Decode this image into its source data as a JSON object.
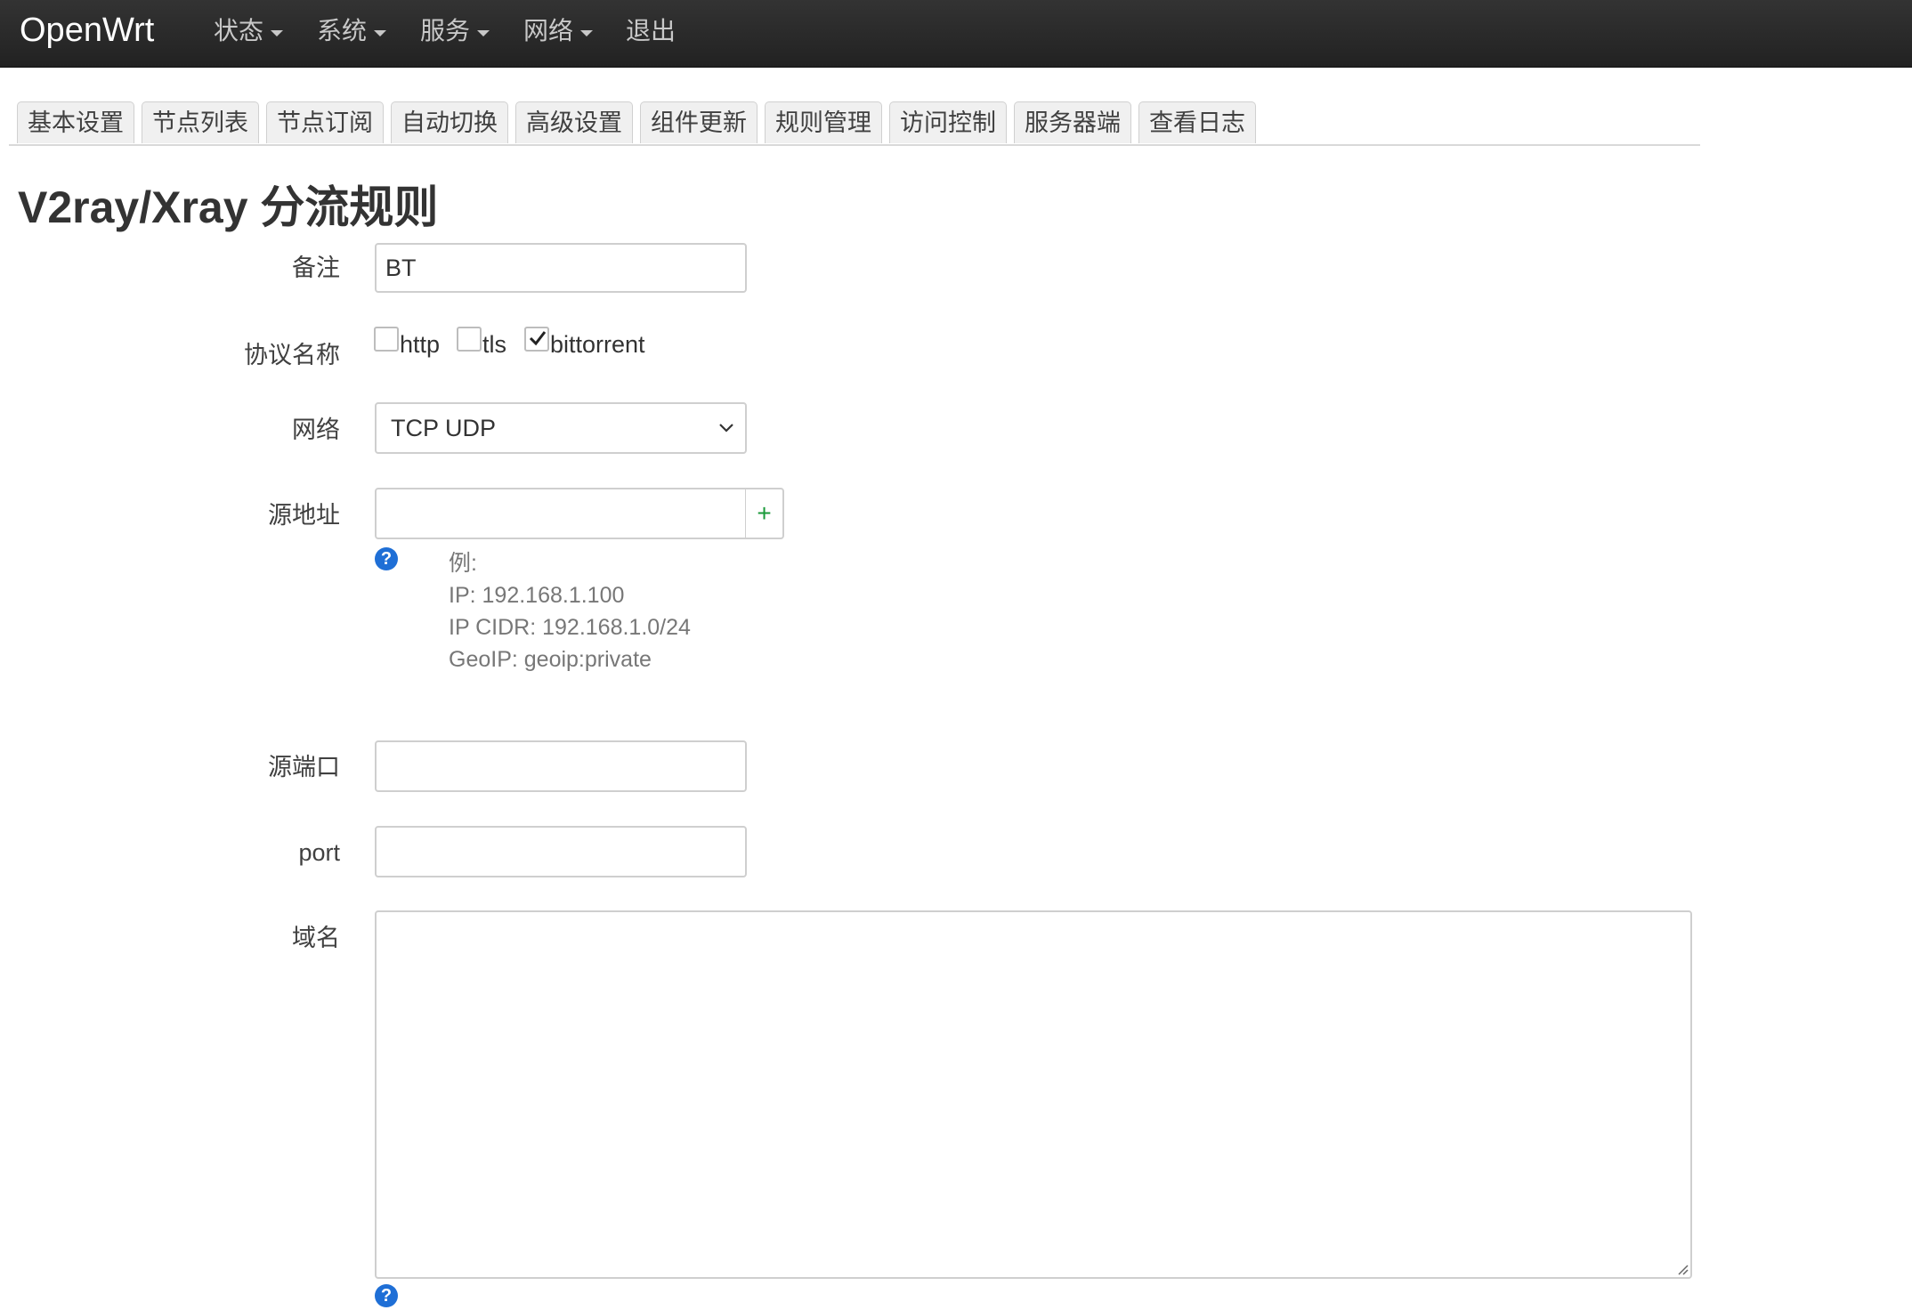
{
  "navbar": {
    "brand": "OpenWrt",
    "menu": [
      "状态",
      "系统",
      "服务",
      "网络",
      "退出"
    ]
  },
  "tabs": [
    "基本设置",
    "节点列表",
    "节点订阅",
    "自动切换",
    "高级设置",
    "组件更新",
    "规则管理",
    "访问控制",
    "服务器端",
    "查看日志"
  ],
  "page": {
    "title": "V2ray/Xray 分流规则"
  },
  "form": {
    "remarks": {
      "label": "备注",
      "value": "BT"
    },
    "protocol": {
      "label": "协议名称",
      "options": [
        {
          "label": "http",
          "checked": false
        },
        {
          "label": "tls",
          "checked": false
        },
        {
          "label": "bittorrent",
          "checked": true
        }
      ]
    },
    "network": {
      "label": "网络",
      "value": "TCP UDP"
    },
    "source": {
      "label": "源地址",
      "value": "",
      "add_label": "+",
      "help": [
        "例:",
        "IP: 192.168.1.100",
        "IP CIDR: 192.168.1.0/24",
        "GeoIP: geoip:private"
      ]
    },
    "source_port": {
      "label": "源端口",
      "value": ""
    },
    "port": {
      "label": "port",
      "value": ""
    },
    "domain": {
      "label": "域名",
      "value": ""
    },
    "help_icon_glyph": "?"
  },
  "colors": {
    "navbar": "#222222",
    "help_icon": "#1f6fd6",
    "add_button": "#1a9a3a"
  }
}
